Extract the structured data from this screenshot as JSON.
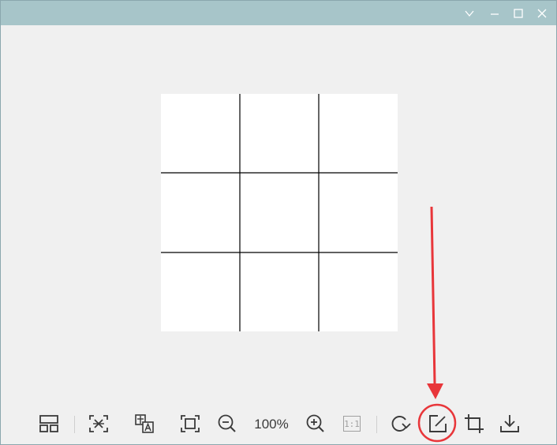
{
  "window": {
    "controls": {
      "collapse_icon": "chevron-down-icon",
      "minimize_icon": "minimize-icon",
      "maximize_icon": "maximize-icon",
      "close_icon": "close-icon"
    }
  },
  "viewer": {
    "image_description_icon": "grid-image"
  },
  "toolbar": {
    "zoom_level": "100%",
    "actual_size_label": "1:1",
    "tools": [
      "layout-icon",
      "ocr-icon",
      "translate-icon",
      "fit-screen-icon",
      "zoom-out-icon",
      "zoom-in-icon",
      "actual-size-icon",
      "rotate-icon",
      "edit-icon",
      "crop-icon",
      "download-icon"
    ]
  },
  "colors": {
    "titlebar": "#a7c5c9",
    "background": "#f0f0f0",
    "icon": "#3a3a3a",
    "annotation": "#e8363a"
  }
}
